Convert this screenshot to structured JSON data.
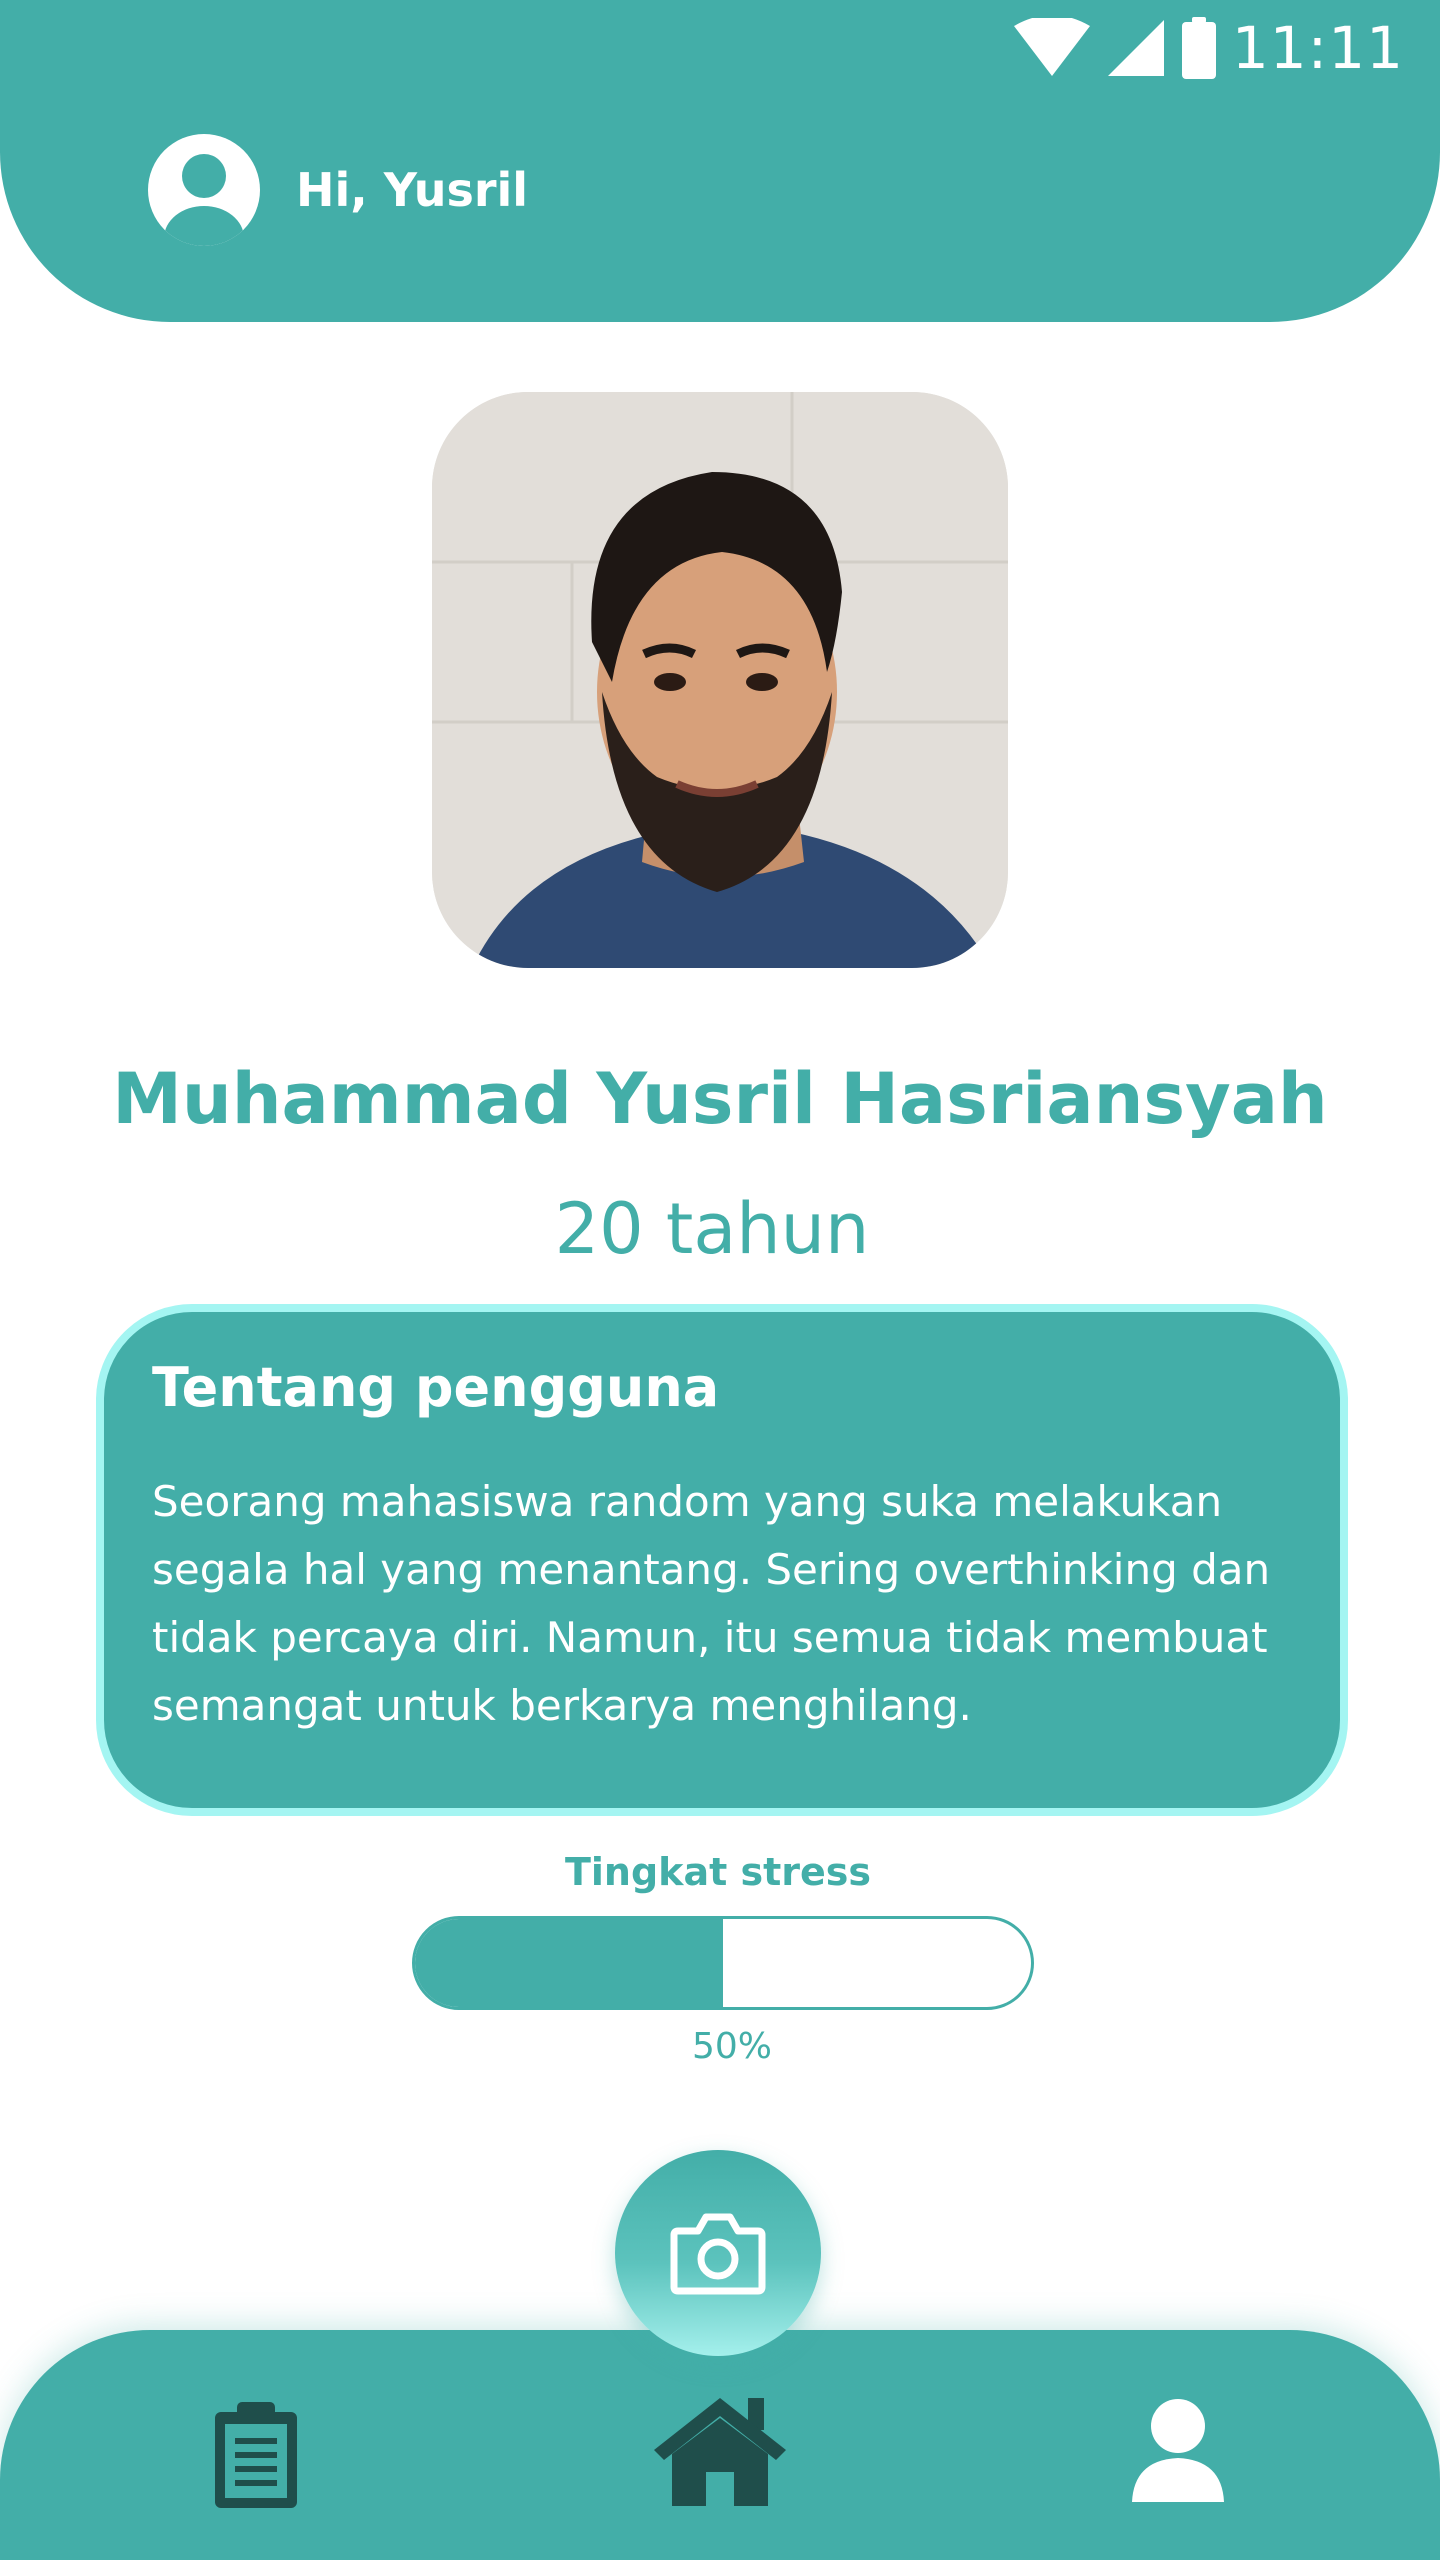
{
  "status_bar": {
    "time": "11:11"
  },
  "header": {
    "greeting": "Hi, Yusril"
  },
  "profile": {
    "name": "Muhammad Yusril Hasriansyah",
    "age": "20 tahun"
  },
  "about": {
    "title": "Tentang pengguna",
    "body": "Seorang mahasiswa random yang suka melakukan segala hal yang menantang. Sering overthinking dan tidak percaya diri. Namun, itu semua tidak membuat semangat untuk berkarya menghilang."
  },
  "stress": {
    "label": "Tingkat stress",
    "value_text": "50%",
    "level": 0.5
  },
  "nav": {
    "items": [
      {
        "icon": "clipboard-icon"
      },
      {
        "icon": "home-icon"
      },
      {
        "icon": "profile-icon"
      }
    ],
    "fab_icon": "camera-icon"
  },
  "colors": {
    "primary": "#43aea8",
    "card_border": "#a4f5f2",
    "nav_icon_dark": "#1f4e4b",
    "background": "#ffffff"
  }
}
